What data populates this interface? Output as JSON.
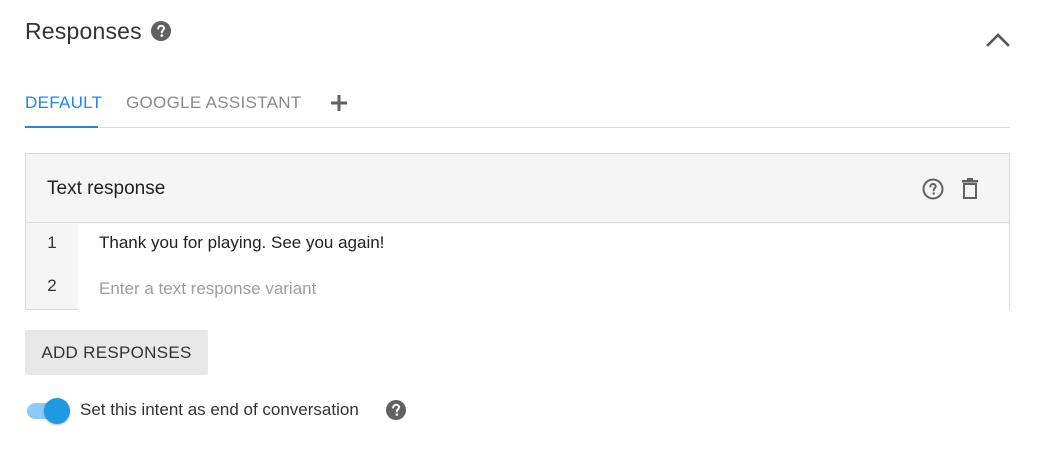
{
  "section": {
    "title": "Responses",
    "help_icon": "help-circle-icon",
    "collapse_icon": "chevron-up-icon"
  },
  "tabs": [
    {
      "label": "DEFAULT",
      "active": true
    },
    {
      "label": "GOOGLE ASSISTANT",
      "active": false
    }
  ],
  "add_tab_icon": "plus-icon",
  "text_response": {
    "title": "Text response",
    "help_icon": "help-outline-icon",
    "delete_icon": "trash-icon",
    "rows": [
      {
        "number": "1",
        "text": "Thank you for playing. See you again!"
      },
      {
        "number": "2",
        "placeholder": "Enter a text response variant"
      }
    ]
  },
  "add_responses_label": "ADD RESPONSES",
  "end_conversation": {
    "label": "Set this intent as end of conversation",
    "enabled": true,
    "help_icon": "help-circle-icon"
  },
  "colors": {
    "accent": "#1e88e5",
    "toggle_knob": "#1e9ae0",
    "toggle_track": "#90caf9"
  }
}
